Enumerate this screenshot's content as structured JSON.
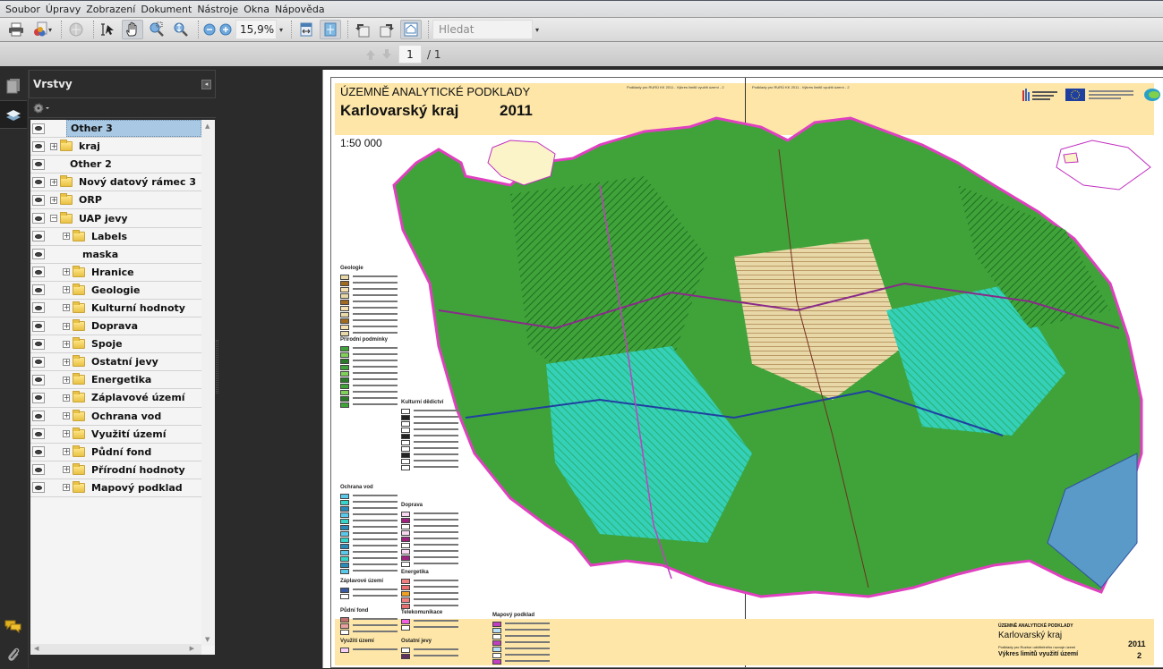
{
  "menu": [
    "Soubor",
    "Úpravy",
    "Zobrazení",
    "Dokument",
    "Nástroje",
    "Okna",
    "Nápověda"
  ],
  "toolbar": {
    "zoom_value": "15,9%",
    "search_placeholder": "Hledat",
    "tools": [
      "print-icon",
      "create-pdf-icon",
      "collaborate-icon",
      "select-text-icon",
      "hand-tool-icon",
      "marquee-zoom-icon",
      "dynamic-zoom-icon",
      "zoom-out-icon",
      "zoom-in-icon",
      "fit-width-icon",
      "fit-page-icon",
      "rotate-left-icon",
      "rotate-right-icon",
      "read-mode-icon"
    ]
  },
  "nav": {
    "page_current": "1",
    "page_total": "/ 1"
  },
  "panel": {
    "title": "Vrstvy",
    "layers": [
      {
        "label": "Other 3",
        "expander": "",
        "folder": false,
        "indent": 0,
        "selected": true
      },
      {
        "label": "kraj",
        "expander": "+",
        "folder": true,
        "indent": 0
      },
      {
        "label": "Other 2",
        "expander": "",
        "folder": false,
        "indent": 0
      },
      {
        "label": "Nový datový rámec 3",
        "expander": "+",
        "folder": true,
        "indent": 0
      },
      {
        "label": "ORP",
        "expander": "+",
        "folder": true,
        "indent": 0
      },
      {
        "label": "UAP jevy",
        "expander": "−",
        "folder": true,
        "indent": 0
      },
      {
        "label": "Labels",
        "expander": "+",
        "folder": true,
        "indent": 1
      },
      {
        "label": "maska",
        "expander": "",
        "folder": false,
        "indent": 1
      },
      {
        "label": "Hranice",
        "expander": "+",
        "folder": true,
        "indent": 1
      },
      {
        "label": "Geologie",
        "expander": "+",
        "folder": true,
        "indent": 1
      },
      {
        "label": "Kulturní hodnoty",
        "expander": "+",
        "folder": true,
        "indent": 1
      },
      {
        "label": "Doprava",
        "expander": "+",
        "folder": true,
        "indent": 1
      },
      {
        "label": "Spoje",
        "expander": "+",
        "folder": true,
        "indent": 1
      },
      {
        "label": "Ostatní jevy",
        "expander": "+",
        "folder": true,
        "indent": 1
      },
      {
        "label": "Energetika",
        "expander": "+",
        "folder": true,
        "indent": 1
      },
      {
        "label": "Záplavové území",
        "expander": "+",
        "folder": true,
        "indent": 1
      },
      {
        "label": "Ochrana vod",
        "expander": "+",
        "folder": true,
        "indent": 1
      },
      {
        "label": "Využití území",
        "expander": "+",
        "folder": true,
        "indent": 1
      },
      {
        "label": "Půdní fond",
        "expander": "+",
        "folder": true,
        "indent": 1
      },
      {
        "label": "Přírodní hodnoty",
        "expander": "+",
        "folder": true,
        "indent": 1
      },
      {
        "label": "Mapový podklad",
        "expander": "+",
        "folder": true,
        "indent": 1
      }
    ]
  },
  "document": {
    "subtitle": "ÚZEMNĚ ANALYTICKÉ PODKLADY",
    "title": "Karlovarský kraj",
    "year": "2011",
    "scale": "1:50 000",
    "header_note": "Podklady pro RURÚ KK 2011 - Výkres limitů využití území - 2",
    "legend_sections": [
      "Geologie",
      "Přírodní podmínky",
      "Kulturní dědictví",
      "Ochrana vod",
      "Doprava",
      "Energetika",
      "Záplavové území",
      "Půdní fond",
      "Telekomunikace",
      "Využití území",
      "Ostatní jevy",
      "Mapový podklad"
    ],
    "footer": {
      "subtitle": "ÚZEMNĚ ANALYTICKÉ PODKLADY",
      "title": "Karlovarský kraj",
      "desc": "Podklady pro Rozbor udržitelného rozvoje území",
      "drawing": "Výkres limitů využití území",
      "year": "2011",
      "sheet": "2"
    },
    "colors": {
      "header_band": "#fde6a8",
      "forest": "#3fa33a",
      "water": "#33d6c8",
      "boundary": "#e040c0"
    }
  }
}
